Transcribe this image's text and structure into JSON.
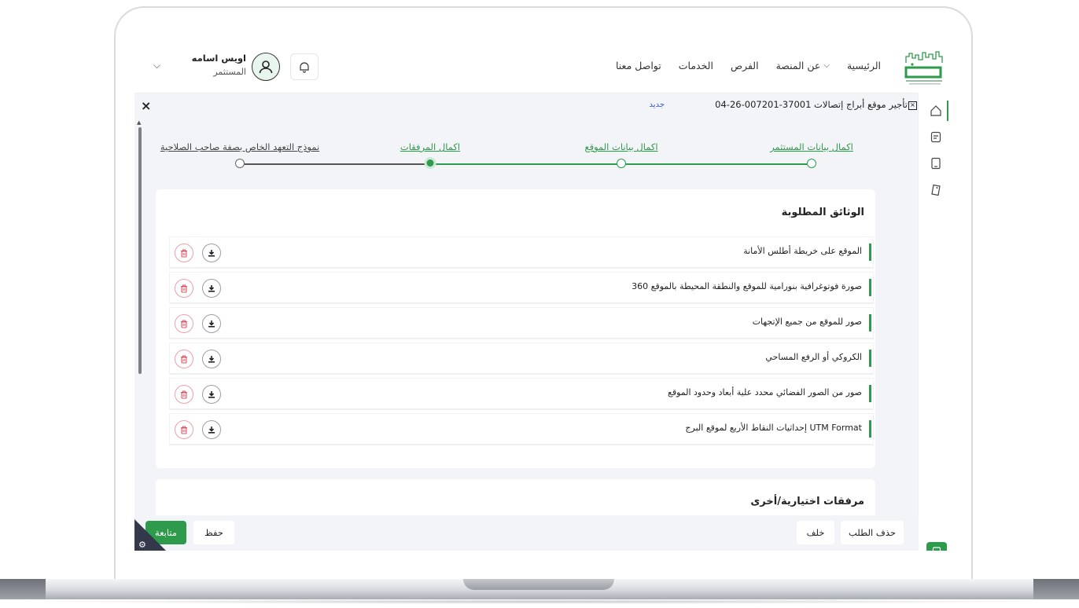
{
  "header": {
    "nav": [
      {
        "label": "الرئيسية",
        "has_dropdown": false
      },
      {
        "label": "عن المنصة",
        "has_dropdown": true
      },
      {
        "label": "الفرص",
        "has_dropdown": false
      },
      {
        "label": "الخدمات",
        "has_dropdown": false
      },
      {
        "label": "تواصل معنا",
        "has_dropdown": false
      }
    ],
    "user": {
      "name": "اويس اسامه",
      "role": "المستثمر"
    }
  },
  "request": {
    "title": "تأجير موقع أبراج إتصالات 37001-007201-26-04",
    "status": "جديد"
  },
  "steps": [
    {
      "label": "اكمال بيانات المستثمر",
      "state": "done"
    },
    {
      "label": "اكمال بيانات الموقع",
      "state": "done"
    },
    {
      "label": "اكمال المرفقات",
      "state": "current"
    },
    {
      "label": "نموذج التعهد الخاص بصفة صاحب الصلاحية",
      "state": "pending"
    }
  ],
  "documents": {
    "title": "الوثائق المطلوبة",
    "items": [
      "الموقع على خريطة أطلس الأمانة",
      "صورة فوتوغرافية بنورامية للموقع والنطقة المحيطة بالموقع 360",
      "صور للموقع من جميع الإتجهات",
      "الكروكي أو الرفع المساحي",
      "صور من الصور الفضائي محدد علية أبعاد وحدود الموقع",
      "UTM Format إحداثيات النقاط الأربع لموقع البرج"
    ]
  },
  "optional": {
    "title": "مرفقات اختيارية/أخرى"
  },
  "footer": {
    "delete_request": "حذف الطلب",
    "back": "خلف",
    "save": "حفظ",
    "continue": "متابعة"
  },
  "colors": {
    "accent": "#2e9a4b",
    "delete": "#e7a1a8",
    "status_new": "#3a5bd0"
  },
  "icons": [
    "bell-icon",
    "user-icon",
    "home-icon",
    "clipboard-icon",
    "document-icon",
    "tag-icon",
    "download-icon",
    "trash-icon",
    "close-icon",
    "gear-icon"
  ]
}
